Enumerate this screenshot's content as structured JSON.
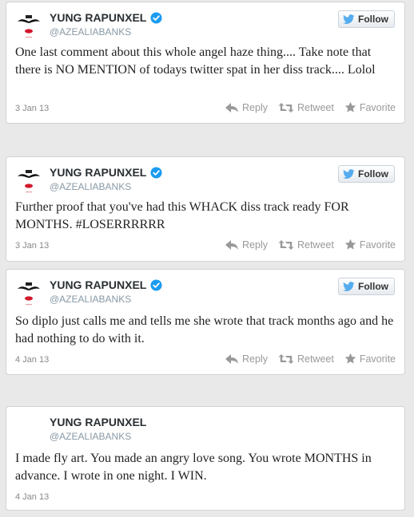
{
  "follow_label": "Follow",
  "actions": {
    "reply": "Reply",
    "retweet": "Retweet",
    "favorite": "Favorite"
  },
  "tweets": [
    {
      "name": "YUNG RAPUNXEL",
      "handle": "@AZEALIABANKS",
      "text": "One last comment about this whole angel haze thing.... Take note that there is NO MENTION of todays twitter spat in her diss track.... Lolol",
      "date": "3 Jan 13"
    },
    {
      "name": "YUNG RAPUNXEL",
      "handle": "@AZEALIABANKS",
      "text": "Further proof that you've had this WHACK diss track ready FOR MONTHS. #LOSERRRRRR",
      "date": "3 Jan 13"
    },
    {
      "name": "YUNG RAPUNXEL",
      "handle": "@AZEALIABANKS",
      "text": "So diplo just calls me and tells me she wrote that track months ago and he had nothing to do with it.",
      "date": "4 Jan 13"
    },
    {
      "name": "YUNG RAPUNXEL",
      "handle": "@AZEALIABANKS",
      "text": "I made fly art. You made an angry love song. You wrote MONTHS in advance. I wrote in one night. I WIN.",
      "date": "4 Jan 13"
    }
  ],
  "colors": {
    "verified": "#1d9bf0",
    "bird": "#55acee",
    "name": "#292f33",
    "muted": "#8899a6"
  },
  "icons": [
    "avatar-mustache-lips",
    "verified-badge-icon",
    "twitter-bird-icon",
    "reply-arrow-icon",
    "retweet-icon",
    "favorite-star-icon"
  ]
}
